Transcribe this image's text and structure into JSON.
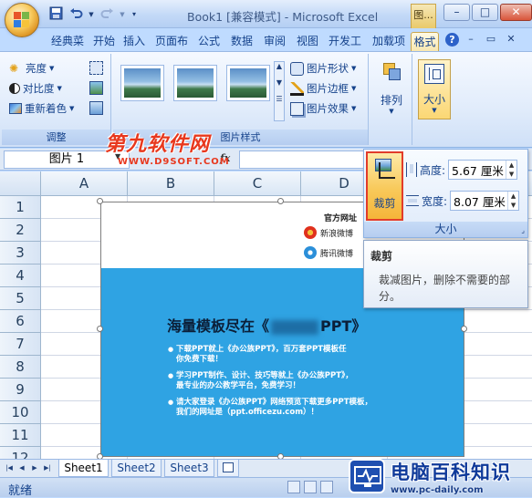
{
  "window": {
    "title": "Book1  [兼容模式] - Microsoft Excel",
    "context_tab_top": "图...",
    "controls": [
      "–",
      "□",
      "✕"
    ]
  },
  "quick_access": {
    "icons": [
      "save-icon",
      "undo-icon",
      "redo-icon",
      "customize-icon"
    ]
  },
  "tabs": [
    {
      "label": "经典菜单"
    },
    {
      "label": "开始"
    },
    {
      "label": "插入"
    },
    {
      "label": "页面布局"
    },
    {
      "label": "公式"
    },
    {
      "label": "数据"
    },
    {
      "label": "审阅"
    },
    {
      "label": "视图"
    },
    {
      "label": "开发工具"
    },
    {
      "label": "加载项"
    },
    {
      "label": "格式",
      "active": true
    }
  ],
  "tab_display": [
    "经典菜",
    "开始",
    "插入",
    "页面布",
    "公式",
    "数据",
    "审阅",
    "视图",
    "开发工",
    "加载项",
    "格式"
  ],
  "ribbon": {
    "adjust": {
      "brightness": "亮度",
      "contrast": "对比度",
      "recolor": "重新着色",
      "label": "调整"
    },
    "styles": {
      "shape": "图片形状",
      "border": "图片边框",
      "effects": "图片效果",
      "label": "图片样式"
    },
    "arrange": {
      "label": "排列"
    },
    "size": {
      "label": "大小"
    }
  },
  "formula_bar": {
    "name_box": "图片 1",
    "fx": "fx"
  },
  "watermark": {
    "line1": "第九软件网",
    "line2": "WWW.D9SOFT.COM"
  },
  "grid": {
    "columns": [
      "A",
      "B",
      "C",
      "D"
    ],
    "rows": [
      "1",
      "2",
      "3",
      "4",
      "5",
      "6",
      "7",
      "8",
      "9",
      "10",
      "11",
      "12"
    ]
  },
  "picture": {
    "official_site": "官方网址",
    "social": [
      "新浪微博",
      "腾讯微博"
    ],
    "headline_pre": "海量模板尽在《",
    "headline_post": "PPT》",
    "bullets": [
      [
        "下载PPT就上《办公族PPT》，百万套PPT模板任",
        "你免费下载！"
      ],
      [
        "学习PPT制作、设计、技巧等就上《办公族PPT》，",
        "最专业的办公教学平台，免费学习！"
      ],
      [
        "请大家登录《办公族PPT》网络预览下载更多PPT模板，",
        "我们的网址是（ppt.officezu.com）！"
      ]
    ]
  },
  "size_panel": {
    "crop_label": "裁剪",
    "height_label": "高度:",
    "height_value": "5.67 厘米",
    "width_label": "宽度:",
    "width_value": "8.07 厘米",
    "group_label": "大小"
  },
  "tooltip": {
    "title": "裁剪",
    "body": "裁减图片，删除不需要的部分。"
  },
  "sheets": [
    {
      "label": "Sheet1",
      "active": true
    },
    {
      "label": "Sheet2"
    },
    {
      "label": "Sheet3"
    }
  ],
  "status": {
    "ready": "就绪"
  },
  "brand": {
    "name": "电脑百科知识",
    "url": "www.pc-daily.com"
  },
  "colors": {
    "ribbon_bg": "#bfdbff",
    "picture_blue": "#2fa3e3",
    "crop_highlight": "#e23c2a",
    "watermark_red": "#e8381e"
  }
}
